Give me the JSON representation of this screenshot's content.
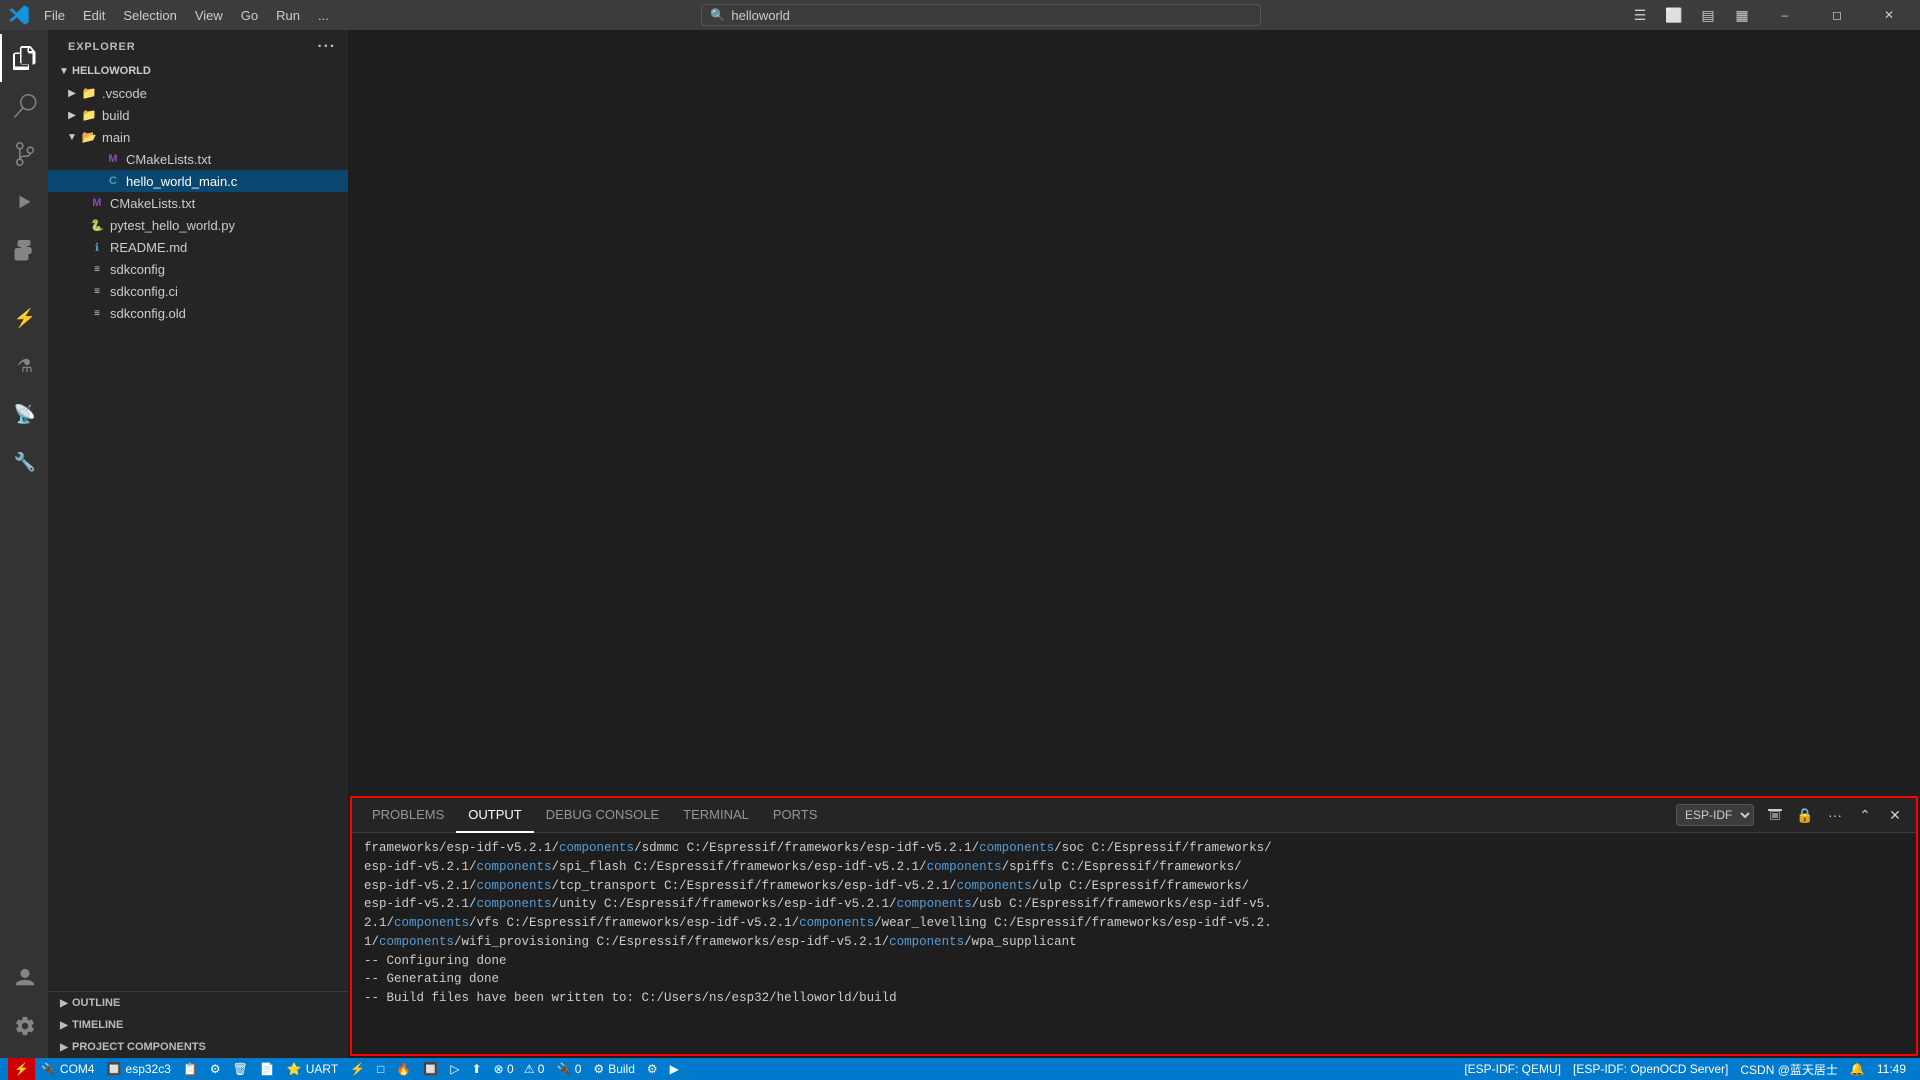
{
  "titleBar": {
    "menuItems": [
      "File",
      "Edit",
      "Selection",
      "View",
      "Go",
      "Run",
      "..."
    ],
    "searchPlaceholder": "helloworld",
    "windowControls": [
      "minimize",
      "restore",
      "maximize-restore",
      "layout",
      "close"
    ]
  },
  "activityBar": {
    "icons": [
      {
        "name": "explorer-icon",
        "symbol": "⎘",
        "active": true
      },
      {
        "name": "search-icon",
        "symbol": "🔍",
        "active": false
      },
      {
        "name": "source-control-icon",
        "symbol": "⎇",
        "active": false
      },
      {
        "name": "run-debug-icon",
        "symbol": "▶",
        "active": false
      },
      {
        "name": "extensions-icon",
        "symbol": "⊞",
        "active": false
      },
      {
        "name": "idf-icon",
        "symbol": "⚡",
        "active": false
      },
      {
        "name": "test-icon",
        "symbol": "⚗",
        "active": false
      },
      {
        "name": "monitor-icon",
        "symbol": "📡",
        "active": false
      },
      {
        "name": "build-icon",
        "symbol": "🔨",
        "active": false
      }
    ],
    "bottomIcons": [
      {
        "name": "account-icon",
        "symbol": "👤"
      },
      {
        "name": "settings-icon",
        "symbol": "⚙"
      }
    ]
  },
  "sidebar": {
    "header": "EXPLORER",
    "project": "HELLOWORLD",
    "tree": [
      {
        "id": "vscode",
        "label": ".vscode",
        "type": "folder",
        "indent": 1,
        "collapsed": true,
        "arrow": "▶"
      },
      {
        "id": "build",
        "label": "build",
        "type": "folder",
        "indent": 1,
        "collapsed": true,
        "arrow": "▶"
      },
      {
        "id": "main",
        "label": "main",
        "type": "folder",
        "indent": 1,
        "collapsed": false,
        "arrow": "▼"
      },
      {
        "id": "cmakelists-main",
        "label": "CMakeLists.txt",
        "type": "cmake",
        "indent": 2,
        "color": "#8c4cae"
      },
      {
        "id": "hello-world-main",
        "label": "hello_world_main.c",
        "type": "c",
        "indent": 2,
        "color": "#519aba",
        "selected": true
      },
      {
        "id": "cmakelists-root",
        "label": "CMakeLists.txt",
        "type": "cmake",
        "indent": 1,
        "color": "#8c4cae"
      },
      {
        "id": "pytest",
        "label": "pytest_hello_world.py",
        "type": "python",
        "indent": 1,
        "color": "#f1e05a"
      },
      {
        "id": "readme",
        "label": "README.md",
        "type": "markdown",
        "indent": 1,
        "color": "#519aba"
      },
      {
        "id": "sdkconfig",
        "label": "sdkconfig",
        "type": "config",
        "indent": 1
      },
      {
        "id": "sdkconfig-ci",
        "label": "sdkconfig.ci",
        "type": "config",
        "indent": 1
      },
      {
        "id": "sdkconfig-old",
        "label": "sdkconfig.old",
        "type": "config",
        "indent": 1
      }
    ]
  },
  "sidebarBottom": {
    "outline": "OUTLINE",
    "timeline": "TIMELINE",
    "projectComponents": "PROJECT COMPONENTS"
  },
  "panel": {
    "tabs": [
      "PROBLEMS",
      "OUTPUT",
      "DEBUG CONSOLE",
      "TERMINAL",
      "PORTS"
    ],
    "activeTab": "OUTPUT",
    "espIdfLabel": "ESP-IDF",
    "outputLines": [
      "frameworks/esp-idf-v5.2.1/components/sdmmc C:/Espressif/frameworks/esp-idf-v5.2.1/components/soc C:/Espressif/frameworks/esp-idf-v5.2.1/components/spi_flash C:/Espressif/frameworks/esp-idf-v5.2.1/components/spiffs C:/Espressif/frameworks/esp-idf-v5.2.1/components/tcp_transport C:/Espressif/frameworks/esp-idf-v5.2.1/components/ulp C:/Espressif/frameworks/esp-idf-v5.2.1/components/unity C:/Espressif/frameworks/esp-idf-v5.2.1/components/usb C:/Espressif/frameworks/esp-idf-v5.2.1/components/vfs C:/Espressif/frameworks/esp-idf-v5.2.1/components/wear_levelling C:/Espressif/frameworks/esp-idf-v5.2.1/components/wifi_provisioning C:/Espressif/frameworks/esp-idf-v5.2.1/components/wpa_supplicant",
      "-- Configuring done",
      "-- Generating done",
      "-- Build files have been written to: C:/Users/ns/esp32/helloworld/build"
    ],
    "buildPath": "C:/Users/ns/esp32/helloworld/build"
  },
  "statusBar": {
    "left": [
      {
        "label": "⚡ COM4"
      },
      {
        "label": "🔲 esp32c3"
      },
      {
        "label": "📋"
      },
      {
        "label": "⚙"
      },
      {
        "label": "🗑"
      },
      {
        "label": "📄"
      },
      {
        "label": "⭐ UART"
      },
      {
        "label": "⚡"
      },
      {
        "label": "□"
      },
      {
        "label": "🔥"
      },
      {
        "label": "🔲"
      },
      {
        "label": "▷"
      },
      {
        "label": "⬆"
      },
      {
        "label": "⊗ 0  ⚠ 0"
      },
      {
        "label": "🔌 0"
      },
      {
        "label": "⚙ Build"
      },
      {
        "label": "⚙"
      },
      {
        "label": "▶"
      }
    ],
    "right": [
      {
        "label": "[ESP-IDF: QEMU]"
      },
      {
        "label": "[ESP-IDF: OpenOCD Server]"
      },
      {
        "label": "CSDN @蓝天居士"
      },
      {
        "label": "🔔"
      },
      {
        "label": "11:49"
      }
    ]
  }
}
